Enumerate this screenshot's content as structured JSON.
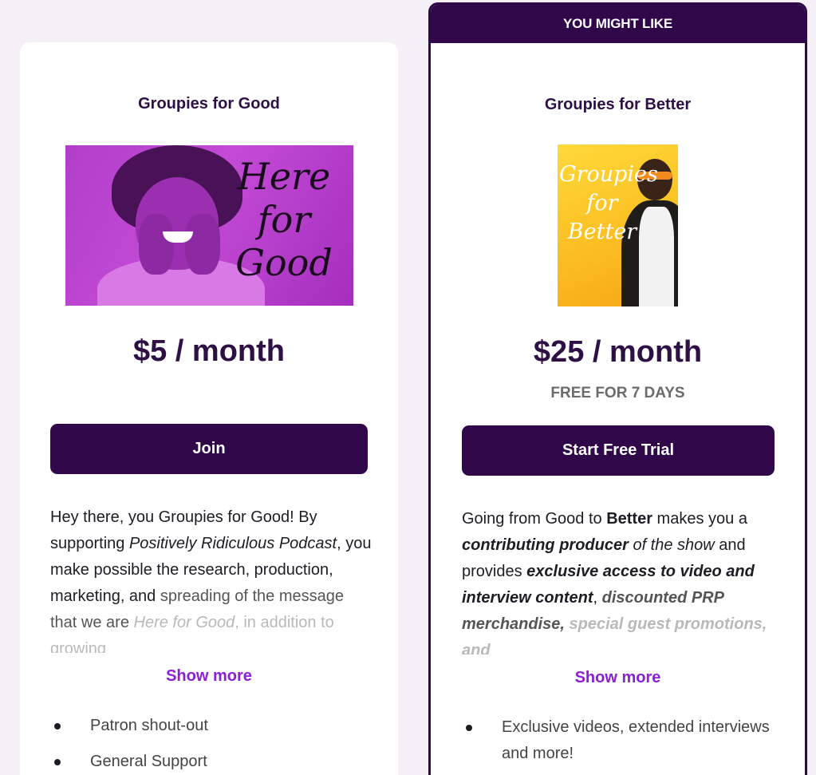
{
  "tiers": [
    {
      "title": "Groupies for Good",
      "image_text": [
        "Here",
        "for",
        "Good"
      ],
      "price": "$5 / month",
      "cta_label": "Join",
      "description": {
        "p1": "Hey there, you Groupies for Good! By supporting ",
        "p1_em": "Positively Ridiculous Podcast",
        "p2": ", you make possible the research, production, marketing, and ",
        "p3": "spreading of the message that we are ",
        "p4_em": "Here for Good",
        "p5": ", in addition to growing"
      },
      "show_more_label": "Show more",
      "benefits": [
        "Patron shout-out",
        "General Support"
      ]
    },
    {
      "ribbon": "YOU MIGHT LIKE",
      "title": "Groupies for Better",
      "image_text": [
        "Groupies",
        "for",
        "Better"
      ],
      "price": "$25 / month",
      "trial_note": "FREE FOR 7 DAYS",
      "cta_label": "Start Free Trial",
      "description": {
        "p1": "Going from Good to ",
        "p1_b": "Better",
        "p2": " makes you a ",
        "p2_bi": "contributing producer",
        "p3": " of the show and provides ",
        "p3_bi": "exclusive access to video and interview content",
        "p4": ",",
        "p5_bi": "discounted PRP merchandise,",
        "p6_bi": "special guest promotions, and"
      },
      "show_more_label": "Show more",
      "benefits": [
        "Exclusive videos, extended interviews and more!"
      ]
    }
  ],
  "colors": {
    "accent": "#30084a",
    "link": "#8a1fd8",
    "background": "#f5eff8"
  }
}
